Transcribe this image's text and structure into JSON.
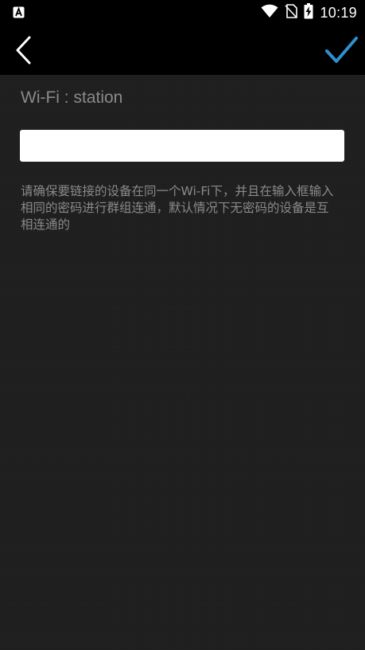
{
  "status_bar": {
    "time": "10:19",
    "icons": [
      "notification-a-icon",
      "wifi-icon",
      "no-sim-icon",
      "battery-charging-icon"
    ]
  },
  "app_bar": {
    "back_icon": "chevron-left-icon",
    "confirm_icon": "checkmark-icon",
    "accent_color": "#2f8fd0"
  },
  "content": {
    "network_label": "Wi-Fi : station",
    "group_input_value": "",
    "hint": "请确保要链接的设备在同一个Wi-Fi下，并且在输入框输入相同的密码进行群组连通，默认情况下无密码的设备是互相连通的"
  }
}
